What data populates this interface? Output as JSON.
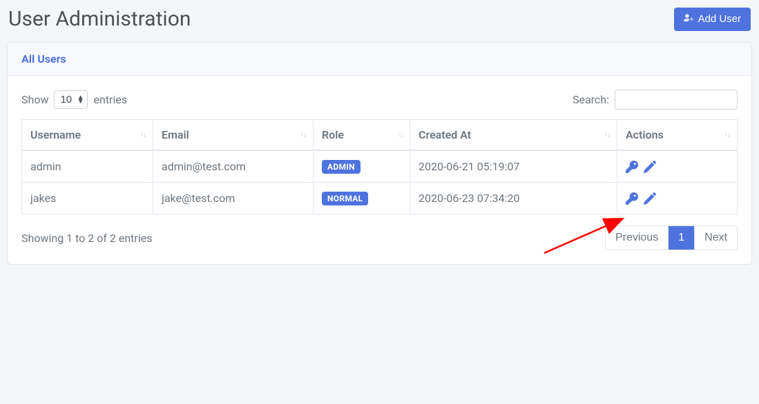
{
  "page": {
    "title": "User Administration",
    "add_user_label": "Add User"
  },
  "card": {
    "header": "All Users"
  },
  "controls": {
    "show_label": "Show",
    "entries_label": "entries",
    "length_value": "10",
    "search_label": "Search:",
    "search_value": ""
  },
  "table": {
    "columns": {
      "username": "Username",
      "email": "Email",
      "role": "Role",
      "created_at": "Created At",
      "actions": "Actions"
    },
    "rows": [
      {
        "username": "admin",
        "email": "admin@test.com",
        "role": "ADMIN",
        "created_at": "2020-06-21 05:19:07"
      },
      {
        "username": "jakes",
        "email": "jake@test.com",
        "role": "NORMAL",
        "created_at": "2020-06-23 07:34:20"
      }
    ]
  },
  "footer": {
    "info": "Showing 1 to 2 of 2 entries",
    "prev_label": "Previous",
    "next_label": "Next",
    "pages": [
      "1"
    ],
    "active_page": "1"
  },
  "colors": {
    "primary": "#4e73df"
  }
}
